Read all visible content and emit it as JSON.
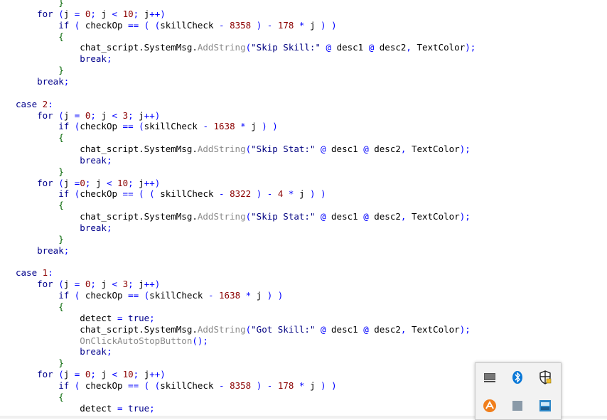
{
  "colors": {
    "keyword": "#00008b",
    "operator": "#0000ff",
    "number": "#8b0000",
    "string": "#000080",
    "method": "#8b8b8b",
    "brace": "#006400",
    "identifier": "#000000"
  },
  "code": {
    "lines": [
      [
        [
          "br",
          "        }"
        ]
      ],
      [
        [
          "kw",
          "    for"
        ],
        [
          "op",
          " ("
        ],
        [
          "id",
          "j"
        ],
        [
          "op",
          " = "
        ],
        [
          "num",
          "0"
        ],
        [
          "op",
          "; "
        ],
        [
          "id",
          "j"
        ],
        [
          "op",
          " < "
        ],
        [
          "num",
          "10"
        ],
        [
          "op",
          "; "
        ],
        [
          "id",
          "j"
        ],
        [
          "op",
          "++)"
        ]
      ],
      [
        [
          "kw",
          "        if"
        ],
        [
          "op",
          " ( "
        ],
        [
          "id",
          "checkOp"
        ],
        [
          "op",
          " == ( ("
        ],
        [
          "id",
          "skillCheck"
        ],
        [
          "op",
          " - "
        ],
        [
          "num",
          "8358"
        ],
        [
          "op",
          " ) - "
        ],
        [
          "num",
          "178"
        ],
        [
          "op",
          " * "
        ],
        [
          "id",
          "j"
        ],
        [
          "op",
          " ) )"
        ]
      ],
      [
        [
          "br",
          "        {"
        ]
      ],
      [
        [
          "id",
          "            chat_script.SystemMsg."
        ],
        [
          "fn",
          "AddString"
        ],
        [
          "op",
          "("
        ],
        [
          "str",
          "\"Skip Skill:\""
        ],
        [
          "op",
          " @ "
        ],
        [
          "id",
          "desc1"
        ],
        [
          "op",
          " @ "
        ],
        [
          "id",
          "desc2"
        ],
        [
          "op",
          ", "
        ],
        [
          "id",
          "TextColor"
        ],
        [
          "op",
          ");"
        ]
      ],
      [
        [
          "kw",
          "            break"
        ],
        [
          "op",
          ";"
        ]
      ],
      [
        [
          "br",
          "        }"
        ]
      ],
      [
        [
          "kw",
          "    break"
        ],
        [
          "op",
          ";"
        ]
      ],
      [],
      [
        [
          "kw",
          "case"
        ],
        [
          "op",
          " "
        ],
        [
          "num",
          "2"
        ],
        [
          "op",
          ":"
        ]
      ],
      [
        [
          "kw",
          "    for"
        ],
        [
          "op",
          " ("
        ],
        [
          "id",
          "j"
        ],
        [
          "op",
          " = "
        ],
        [
          "num",
          "0"
        ],
        [
          "op",
          "; "
        ],
        [
          "id",
          "j"
        ],
        [
          "op",
          " < "
        ],
        [
          "num",
          "3"
        ],
        [
          "op",
          "; "
        ],
        [
          "id",
          "j"
        ],
        [
          "op",
          "++)"
        ]
      ],
      [
        [
          "kw",
          "        if"
        ],
        [
          "op",
          " ("
        ],
        [
          "id",
          "checkOp"
        ],
        [
          "op",
          " == ("
        ],
        [
          "id",
          "skillCheck"
        ],
        [
          "op",
          " - "
        ],
        [
          "num",
          "1638"
        ],
        [
          "op",
          " * "
        ],
        [
          "id",
          "j"
        ],
        [
          "op",
          " ) )"
        ]
      ],
      [
        [
          "br",
          "        {"
        ]
      ],
      [
        [
          "id",
          "            chat_script.SystemMsg."
        ],
        [
          "fn",
          "AddString"
        ],
        [
          "op",
          "("
        ],
        [
          "str",
          "\"Skip Stat:\""
        ],
        [
          "op",
          " @ "
        ],
        [
          "id",
          "desc1"
        ],
        [
          "op",
          " @ "
        ],
        [
          "id",
          "desc2"
        ],
        [
          "op",
          ", "
        ],
        [
          "id",
          "TextColor"
        ],
        [
          "op",
          ");"
        ]
      ],
      [
        [
          "kw",
          "            break"
        ],
        [
          "op",
          ";"
        ]
      ],
      [
        [
          "br",
          "        }"
        ]
      ],
      [
        [
          "kw",
          "    for"
        ],
        [
          "op",
          " ("
        ],
        [
          "id",
          "j"
        ],
        [
          "op",
          " ="
        ],
        [
          "num",
          "0"
        ],
        [
          "op",
          "; "
        ],
        [
          "id",
          "j"
        ],
        [
          "op",
          " < "
        ],
        [
          "num",
          "10"
        ],
        [
          "op",
          "; "
        ],
        [
          "id",
          "j"
        ],
        [
          "op",
          "++)"
        ]
      ],
      [
        [
          "kw",
          "        if"
        ],
        [
          "op",
          " ("
        ],
        [
          "id",
          "checkOp"
        ],
        [
          "op",
          " == ( ( "
        ],
        [
          "id",
          "skillCheck"
        ],
        [
          "op",
          " - "
        ],
        [
          "num",
          "8322"
        ],
        [
          "op",
          " ) - "
        ],
        [
          "num",
          "4"
        ],
        [
          "op",
          " * "
        ],
        [
          "id",
          "j"
        ],
        [
          "op",
          " ) )"
        ]
      ],
      [
        [
          "br",
          "        {"
        ]
      ],
      [
        [
          "id",
          "            chat_script.SystemMsg."
        ],
        [
          "fn",
          "AddString"
        ],
        [
          "op",
          "("
        ],
        [
          "str",
          "\"Skip Stat:\""
        ],
        [
          "op",
          " @ "
        ],
        [
          "id",
          "desc1"
        ],
        [
          "op",
          " @ "
        ],
        [
          "id",
          "desc2"
        ],
        [
          "op",
          ", "
        ],
        [
          "id",
          "TextColor"
        ],
        [
          "op",
          ");"
        ]
      ],
      [
        [
          "kw",
          "            break"
        ],
        [
          "op",
          ";"
        ]
      ],
      [
        [
          "br",
          "        }"
        ]
      ],
      [
        [
          "kw",
          "    break"
        ],
        [
          "op",
          ";"
        ]
      ],
      [],
      [
        [
          "kw",
          "case"
        ],
        [
          "op",
          " "
        ],
        [
          "num",
          "1"
        ],
        [
          "op",
          ":"
        ]
      ],
      [
        [
          "kw",
          "    for"
        ],
        [
          "op",
          " ("
        ],
        [
          "id",
          "j"
        ],
        [
          "op",
          " = "
        ],
        [
          "num",
          "0"
        ],
        [
          "op",
          "; "
        ],
        [
          "id",
          "j"
        ],
        [
          "op",
          " < "
        ],
        [
          "num",
          "3"
        ],
        [
          "op",
          "; "
        ],
        [
          "id",
          "j"
        ],
        [
          "op",
          "++)"
        ]
      ],
      [
        [
          "kw",
          "        if"
        ],
        [
          "op",
          " ( "
        ],
        [
          "id",
          "checkOp"
        ],
        [
          "op",
          " == ("
        ],
        [
          "id",
          "skillCheck"
        ],
        [
          "op",
          " - "
        ],
        [
          "num",
          "1638"
        ],
        [
          "op",
          " * "
        ],
        [
          "id",
          "j"
        ],
        [
          "op",
          " ) )"
        ]
      ],
      [
        [
          "br",
          "        {"
        ]
      ],
      [
        [
          "id",
          "            detect"
        ],
        [
          "op",
          " = "
        ],
        [
          "kw",
          "true"
        ],
        [
          "op",
          ";"
        ]
      ],
      [
        [
          "id",
          "            chat_script.SystemMsg."
        ],
        [
          "fn",
          "AddString"
        ],
        [
          "op",
          "("
        ],
        [
          "str",
          "\"Got Skill:\""
        ],
        [
          "op",
          " @ "
        ],
        [
          "id",
          "desc1"
        ],
        [
          "op",
          " @ "
        ],
        [
          "id",
          "desc2"
        ],
        [
          "op",
          ", "
        ],
        [
          "id",
          "TextColor"
        ],
        [
          "op",
          ");"
        ]
      ],
      [
        [
          "fn",
          "            OnClickAutoStopButton"
        ],
        [
          "op",
          "();"
        ]
      ],
      [
        [
          "kw",
          "            break"
        ],
        [
          "op",
          ";"
        ]
      ],
      [
        [
          "br",
          "        }"
        ]
      ],
      [
        [
          "kw",
          "    for"
        ],
        [
          "op",
          " ("
        ],
        [
          "id",
          "j"
        ],
        [
          "op",
          " = "
        ],
        [
          "num",
          "0"
        ],
        [
          "op",
          "; "
        ],
        [
          "id",
          "j"
        ],
        [
          "op",
          " < "
        ],
        [
          "num",
          "10"
        ],
        [
          "op",
          "; "
        ],
        [
          "id",
          "j"
        ],
        [
          "op",
          "++)"
        ]
      ],
      [
        [
          "kw",
          "        if"
        ],
        [
          "op",
          " ( "
        ],
        [
          "id",
          "checkOp"
        ],
        [
          "op",
          " == ( ("
        ],
        [
          "id",
          "skillCheck"
        ],
        [
          "op",
          " - "
        ],
        [
          "num",
          "8358"
        ],
        [
          "op",
          " ) - "
        ],
        [
          "num",
          "178"
        ],
        [
          "op",
          " * "
        ],
        [
          "id",
          "j"
        ],
        [
          "op",
          " ) )"
        ]
      ],
      [
        [
          "br",
          "        {"
        ]
      ],
      [
        [
          "id",
          "            detect"
        ],
        [
          "op",
          " = "
        ],
        [
          "kw",
          "true"
        ],
        [
          "op",
          ";"
        ]
      ]
    ]
  },
  "tray": {
    "icons": [
      "network-monitor-icon",
      "bluetooth-icon",
      "security-shield-icon",
      "orange-app-icon",
      "blank-app-icon",
      "scanner-app-icon"
    ]
  }
}
